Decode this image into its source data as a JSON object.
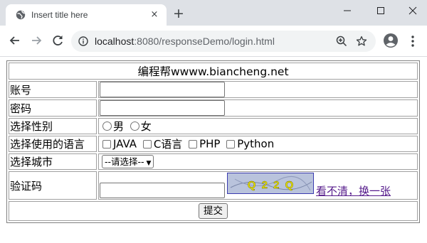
{
  "tab": {
    "title": "Insert title here",
    "close": "×"
  },
  "new_tab": "+",
  "address": {
    "host": "localhost",
    "path": ":8080/responseDemo/login.html"
  },
  "form": {
    "heading": "编程帮wwww.biancheng.net",
    "account_label": "账号",
    "password_label": "密码",
    "gender_label": "选择性别",
    "genders": [
      "男",
      "女"
    ],
    "language_label": "选择使用的语言",
    "languages": [
      "JAVA",
      "C语言",
      "PHP",
      "Python"
    ],
    "city_label": "选择城市",
    "city_select": "--请选择--",
    "captcha_label": "验证码",
    "captcha_text": "Q 2 2 Q",
    "captcha_link": "看不清，换一张",
    "submit": "提交"
  },
  "colors": {
    "chrome": "#dee1e6",
    "omnibox": "#f1f3f4",
    "link": "#551a8b",
    "captcha_bg": "#b9c3dc",
    "captcha_text": "#e8e000"
  }
}
